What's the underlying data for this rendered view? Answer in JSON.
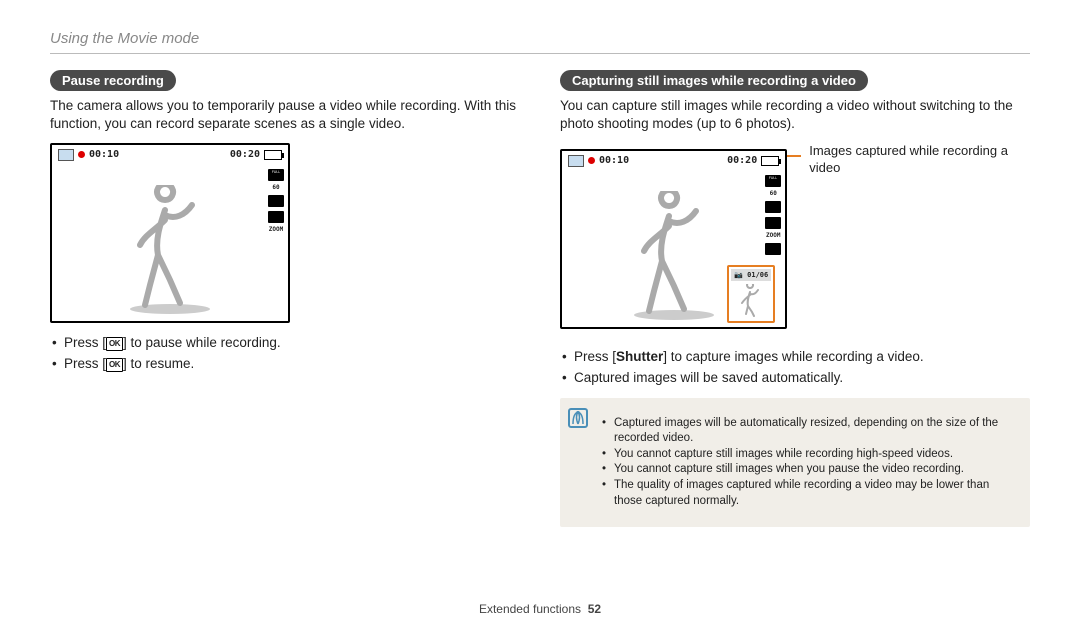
{
  "header": {
    "section": "Using the Movie mode"
  },
  "left": {
    "pill": "Pause recording",
    "para": "The camera allows you to temporarily pause a video while recording. With this function, you can record separate scenes as a single video.",
    "lcd": {
      "timeA": "00:10",
      "timeB": "00:20",
      "lbl60": "60",
      "lblZoom": "ZOOM"
    },
    "bullets": {
      "b1a": "Press [",
      "b1b": "] to pause while recording.",
      "b2a": "Press [",
      "b2b": "] to resume."
    }
  },
  "right": {
    "pill": "Capturing still images while recording a video",
    "para": "You can capture still images while recording a video without switching to the photo shooting modes (up to 6 photos).",
    "lcd": {
      "timeA": "00:10",
      "timeB": "00:20",
      "lbl60": "60",
      "lblZoom": "ZOOM",
      "counter": "01/06"
    },
    "callout": "Images captured while recording a video",
    "bullets": {
      "b1a": "Press [",
      "b1shutter": "Shutter",
      "b1b": "] to capture images while recording a video.",
      "b2": "Captured images will be saved automatically."
    },
    "notes": {
      "n1": "Captured images will be automatically resized, depending on the size of the recorded video.",
      "n2": "You cannot capture still images while recording high-speed videos.",
      "n3": "You cannot capture still images when you pause the video recording.",
      "n4": "The quality of images captured while recording a video may be lower than those captured normally."
    }
  },
  "footer": {
    "chapter": "Extended functions",
    "page": "52"
  }
}
